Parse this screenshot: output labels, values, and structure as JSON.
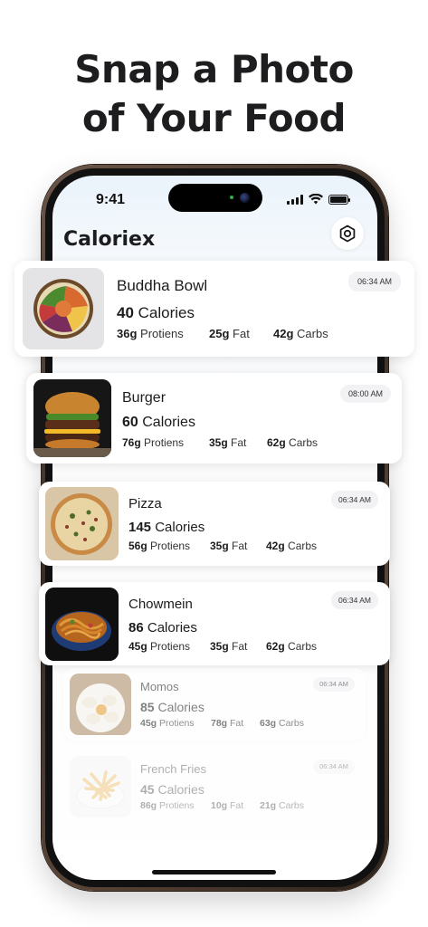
{
  "headline": {
    "line1": "Snap a Photo",
    "line2": "of Your Food"
  },
  "status_bar": {
    "time": "9:41"
  },
  "app": {
    "title": "Caloriex",
    "settings_icon": "settings-icon"
  },
  "labels": {
    "calories": "Calories",
    "proteins": "Protiens",
    "fat": "Fat",
    "carbs": "Carbs"
  },
  "meals": [
    {
      "name": "Buddha Bowl",
      "calories": "40",
      "protein": "36g",
      "fat": "25g",
      "carbs": "42g",
      "time": "06:34 AM"
    },
    {
      "name": "Burger",
      "calories": "60",
      "protein": "76g",
      "fat": "35g",
      "carbs": "62g",
      "time": "08:00 AM"
    },
    {
      "name": "Pizza",
      "calories": "145",
      "protein": "56g",
      "fat": "35g",
      "carbs": "42g",
      "time": "06:34 AM"
    },
    {
      "name": "Chowmein",
      "calories": "86",
      "protein": "45g",
      "fat": "35g",
      "carbs": "62g",
      "time": "06:34 AM"
    },
    {
      "name": "Momos",
      "calories": "85",
      "protein": "45g",
      "fat": "78g",
      "carbs": "63g",
      "time": "06:34 AM"
    },
    {
      "name": "French Fries",
      "calories": "45",
      "protein": "86g",
      "fat": "10g",
      "carbs": "21g",
      "time": "06:34 AM"
    }
  ]
}
